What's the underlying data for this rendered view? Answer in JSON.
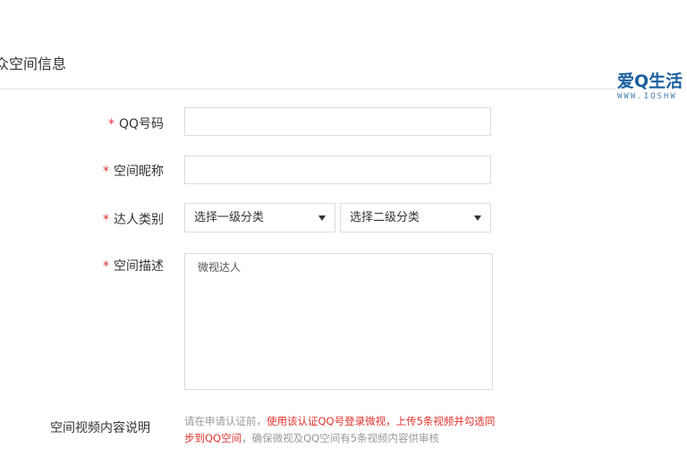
{
  "header": {
    "section_title": "众空间信息"
  },
  "watermark": {
    "logo": "爱Q生活",
    "url": "WWW.IQSHW"
  },
  "form": {
    "qq": {
      "required": "*",
      "label": "QQ号码",
      "value": ""
    },
    "nickname": {
      "required": "*",
      "label": "空间昵称",
      "value": ""
    },
    "category": {
      "required": "*",
      "label": "达人类别",
      "primary": "选择一级分类",
      "secondary": "选择二级分类"
    },
    "description": {
      "required": "*",
      "label": "空间描述",
      "value": "微视达人"
    },
    "video_note": {
      "label": "空间视频内容说明",
      "line1_normal": "请在申请认证前，",
      "line1_highlight": "使用该认证QQ号登录微视，上传5条视频并勾选同",
      "line2_highlight": "步到QQ空间",
      "line2_normal": "，确保微视及QQ空间有5条视频内容供审核"
    }
  }
}
